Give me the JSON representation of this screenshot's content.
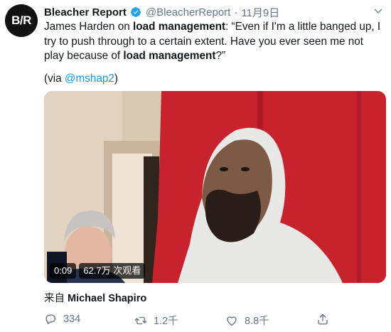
{
  "tweet": {
    "avatar_text": "B/R",
    "display_name": "Bleacher Report",
    "handle": "@BleacherReport",
    "separator": "·",
    "timestamp": "11月9日",
    "text_prefix": "James Harden on ",
    "text_bold_1": "load management",
    "text_middle": ": “Even if I'm a little banged up, I try to push through to a certain extent. Have you ever seen me not play because of ",
    "text_bold_2": "load management",
    "text_suffix": "?”",
    "via_prefix": "(via ",
    "via_link": "@mshap2",
    "via_suffix": ")"
  },
  "video": {
    "elapsed": "0:09",
    "views": "62.7万 次观看"
  },
  "source": {
    "label": "来自",
    "author": "Michael Shapiro"
  },
  "actions": {
    "reply_count": "334",
    "retweet_count": "1.2千",
    "like_count": "8.8千"
  },
  "colors": {
    "link": "#1b95e0",
    "muted": "#657786",
    "verified": "#1da1f2",
    "wall_red": "#c8232c"
  },
  "icons": [
    "bleacher-report-logo",
    "verified-icon",
    "chevron-down-icon",
    "reply-icon",
    "retweet-icon",
    "like-icon",
    "share-icon"
  ]
}
